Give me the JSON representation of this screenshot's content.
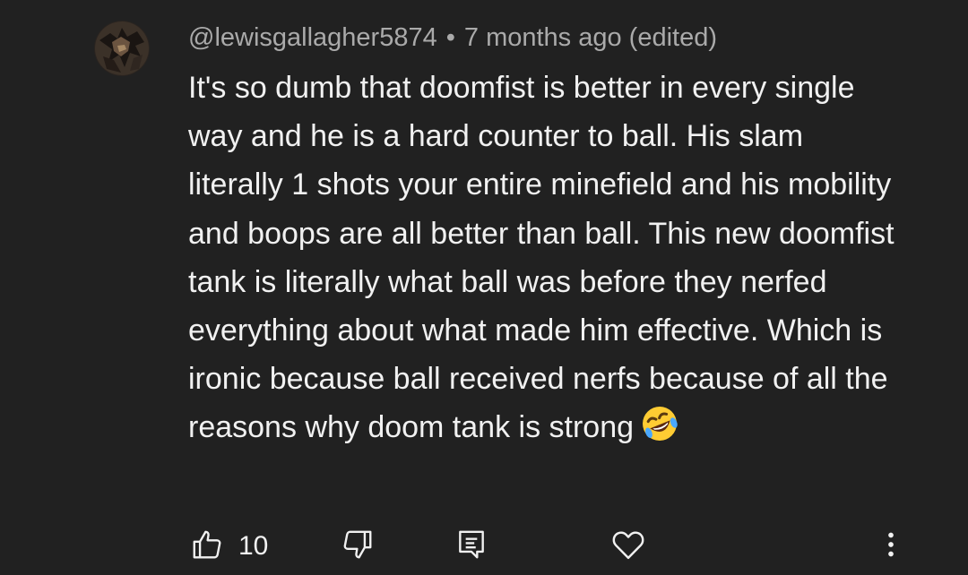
{
  "comment": {
    "author": "@lewisgallagher5874",
    "separator": "•",
    "timestamp": "7 months ago (edited)",
    "text": "It's so dumb that doomfist is better in every single way and he is a hard counter to ball. His slam literally 1 shots your entire minefield and his mobility and boops are all better than ball. This new doomfist tank is literally what ball was before they nerfed everything about what made him effective. Which is ironic because ball received nerfs because of all the reasons why doom tank is strong",
    "emoji": "rolling-on-the-floor-laughing"
  },
  "actions": {
    "like_count": "10",
    "like_icon": "thumbs-up-icon",
    "dislike_icon": "thumbs-down-icon",
    "reply_icon": "reply-comment-icon",
    "heart_icon": "heart-icon",
    "more_icon": "more-vertical-icon"
  },
  "colors": {
    "background": "#212121",
    "text": "#f1f1f1",
    "meta": "#aaaaaa"
  }
}
